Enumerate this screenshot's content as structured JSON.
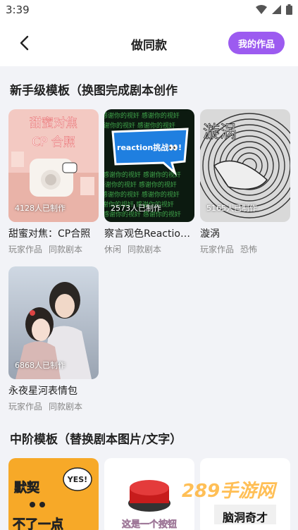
{
  "status": {
    "time": "3:39"
  },
  "header": {
    "title": "做同款",
    "works_button": "我的作品"
  },
  "sections": {
    "beginner_title": "新手级模板（换图完成剧本创作",
    "intermediate_title": "中阶模板（替换剧本图片/文字）"
  },
  "beginner_cards": [
    {
      "title": "甜蜜对焦：CP合照",
      "count": "4128人已制作",
      "tags": [
        "玩家作品",
        "同款剧本"
      ],
      "thumb_text": [
        "甜蜜对焦",
        "CP 合照"
      ]
    },
    {
      "title": "察言观色Reaction挑战",
      "count": "2573人已制作",
      "tags": [
        "休闲",
        "同款剧本"
      ],
      "thumb_text": [
        "reaction挑战👀!"
      ]
    },
    {
      "title": "漩涡",
      "count": "5165人已制作",
      "tags": [
        "玩家作品",
        "恐怖"
      ],
      "thumb_text": [
        "漩涡"
      ]
    },
    {
      "title": "永夜星河表情包",
      "count": "6868人已制作",
      "tags": [
        "玩家作品",
        "同款剧本"
      ],
      "thumb_text": []
    }
  ],
  "intermediate_cards": [
    {
      "thumb_text": [
        "默契",
        "不了一点"
      ],
      "bubble": "YES!"
    },
    {
      "thumb_text": [
        "这是一个按钮"
      ]
    },
    {
      "thumb_text": [
        "脑洞奇才"
      ],
      "watermark": "289手游网"
    }
  ],
  "colors": {
    "accent": "#9c5bf0",
    "background": "#f2f3f7"
  }
}
